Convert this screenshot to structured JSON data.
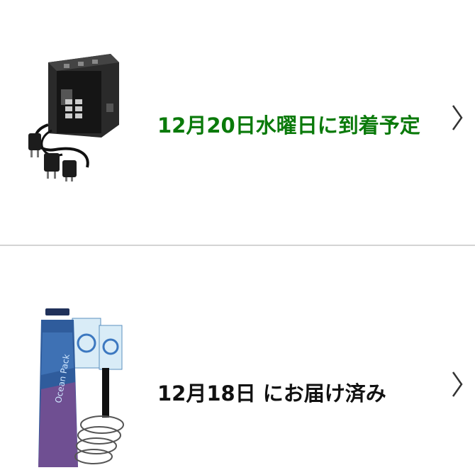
{
  "orders": [
    {
      "status": "12月20日水曜日に到着予定",
      "status_color": "#0a7a0a",
      "product_icon": "power-strip-travel-adapter-product-icon",
      "chevron_icon": "chevron-right-icon"
    },
    {
      "status": "12月18日 にお届け済み",
      "status_color": "#111111",
      "product_icon": "dry-bag-pack-product-icon",
      "chevron_icon": "chevron-right-icon",
      "product_image_text": "Ocean Pack"
    }
  ]
}
